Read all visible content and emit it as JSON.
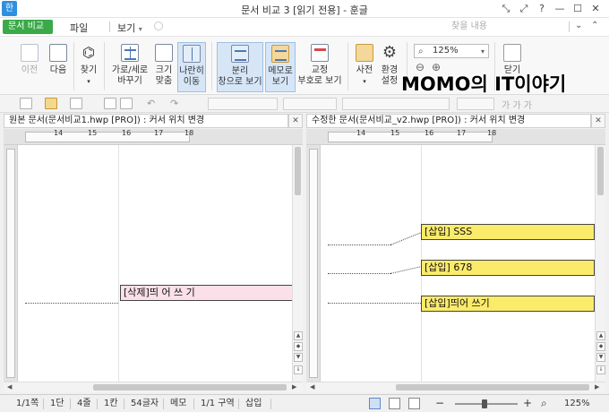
{
  "titlebar": {
    "logo": "한",
    "title": "문서 비교 3 [읽기 전용] - 훈글",
    "buttons": [
      "⤡",
      "⤢",
      "?",
      "—",
      "☐",
      "✕"
    ]
  },
  "menu": {
    "doc_tab": "문서 비교",
    "doc_tab_close": "×",
    "file": "파일",
    "view": "보기",
    "view_arrow": "▾",
    "search_placeholder": "찾을 내용"
  },
  "ribbon": {
    "prev": "이전",
    "next": "다음",
    "find": "찾기",
    "find_arrow": "▾",
    "rotate_line1": "가로/세로",
    "rotate_line2": "바꾸기",
    "fit_line1": "크기",
    "fit_line2": "맞춤",
    "sidebyside_line1": "나란히",
    "sidebyside_line2": "이동",
    "split_line1": "분리",
    "split_line2": "창으로 보기",
    "memo_line1": "메모로",
    "memo_line2": "보기",
    "fixed_line1": "교정",
    "fixed_line2": "부호로 보기",
    "dictionary": "사전",
    "dictionary_arrow": "▾",
    "env_line1": "환경",
    "env_line2": "설정",
    "zoom_value": "125%",
    "zoom_out": "⊖",
    "zoom_in": "⊕",
    "close": "닫기"
  },
  "watermark": "MOMO의 IT이야기",
  "quickbar": {
    "font_buttons": "가 가 가"
  },
  "left_pane": {
    "header": "원본 문서(문서비교1.hwp [PRO]) : 커서 위치 변경",
    "close": "✕",
    "ruler_ticks": [
      "14",
      "15",
      "16",
      "17",
      "18"
    ],
    "changes": [
      {
        "text": "[삭제]띄 어 쓰 기"
      }
    ]
  },
  "right_pane": {
    "header": "수정한 문서(문서비교_v2.hwp [PRO]) : 커서 위치 변경",
    "close": "✕",
    "ruler_ticks": [
      "14",
      "15",
      "16",
      "17",
      "18"
    ],
    "changes": [
      {
        "text": "[삽입] SSS"
      },
      {
        "text": "[삽입] 678"
      },
      {
        "text": "[삽입]띄어 쓰기"
      }
    ]
  },
  "statusbar": {
    "page": "1/1쪽",
    "column": "1단",
    "line": "4줄",
    "char": "1칸",
    "count": "54글자",
    "memo": "메모",
    "section": "1/1 구역",
    "mode": "삽입",
    "zoom": "125%"
  },
  "colors": {
    "doc_tab": "#3aa948",
    "insert_highlight": "#fbeb6b",
    "delete_highlight": "#fbe0ea",
    "active_button": "#d6e6f7"
  }
}
